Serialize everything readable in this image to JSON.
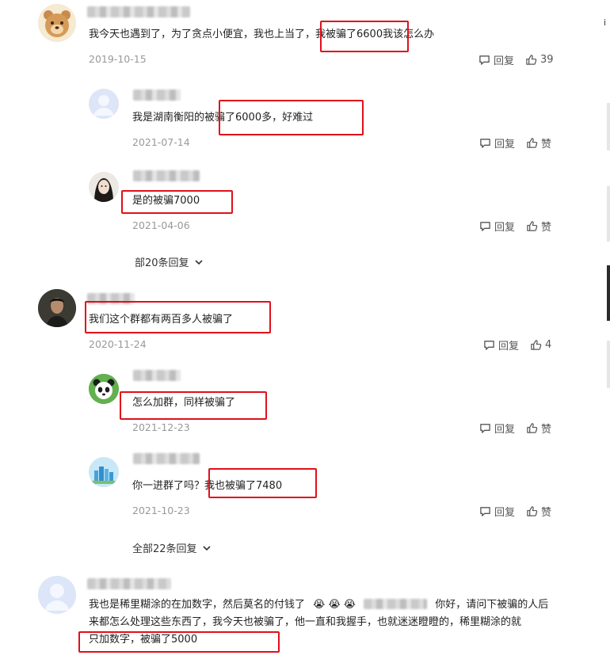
{
  "comments": [
    {
      "text": "我今天也遇到了，为了贪点小便宜，我也上当了，我被骗了6600我该怎么办",
      "date": "2019-10-15",
      "reply_label": "回复",
      "like_count": "39",
      "avatar_icon": "bear-icon"
    },
    {
      "text": "我是湖南衡阳的被骗了6000多，好难过",
      "date": "2021-07-14",
      "reply_label": "回复",
      "like_label": "赞",
      "avatar_icon": "default-user-icon"
    },
    {
      "text": "是的被骗7000",
      "date": "2021-04-06",
      "reply_label": "回复",
      "like_label": "赞",
      "avatar_icon": "woman-photo-icon"
    },
    {
      "more_label": "部20条回复"
    },
    {
      "text": "我们这个群都有两百多人被骗了",
      "date": "2020-11-24",
      "reply_label": "回复",
      "like_count": "4",
      "avatar_icon": "man-photo-icon"
    },
    {
      "text": "怎么加群，同样被骗了",
      "date": "2021-12-23",
      "reply_label": "回复",
      "like_label": "赞",
      "avatar_icon": "panda-icon"
    },
    {
      "text": "你一进群了吗？我也被骗了7480",
      "date": "2021-10-23",
      "reply_label": "回复",
      "like_label": "赞",
      "avatar_icon": "city-icon"
    },
    {
      "more_label": "全部22条回复"
    },
    {
      "text_line1_part1": "我也是稀里糊涂的在加数字，然后莫名的付钱了",
      "text_line1_emoji": "😭 😭 😭",
      "text_line1_part2": "你好，请问下被骗的人后",
      "text_line2": "来都怎么处理这些东西了，我今天也被骗了，他一直和我握手，也就迷迷瞪瞪的，稀里糊涂的就",
      "text_line3": "只加数字，被骗了5000",
      "avatar_icon": "default-user-icon"
    }
  ],
  "colors": {
    "highlight_box": "#e0101a",
    "date": "#999999",
    "action": "#555555"
  }
}
